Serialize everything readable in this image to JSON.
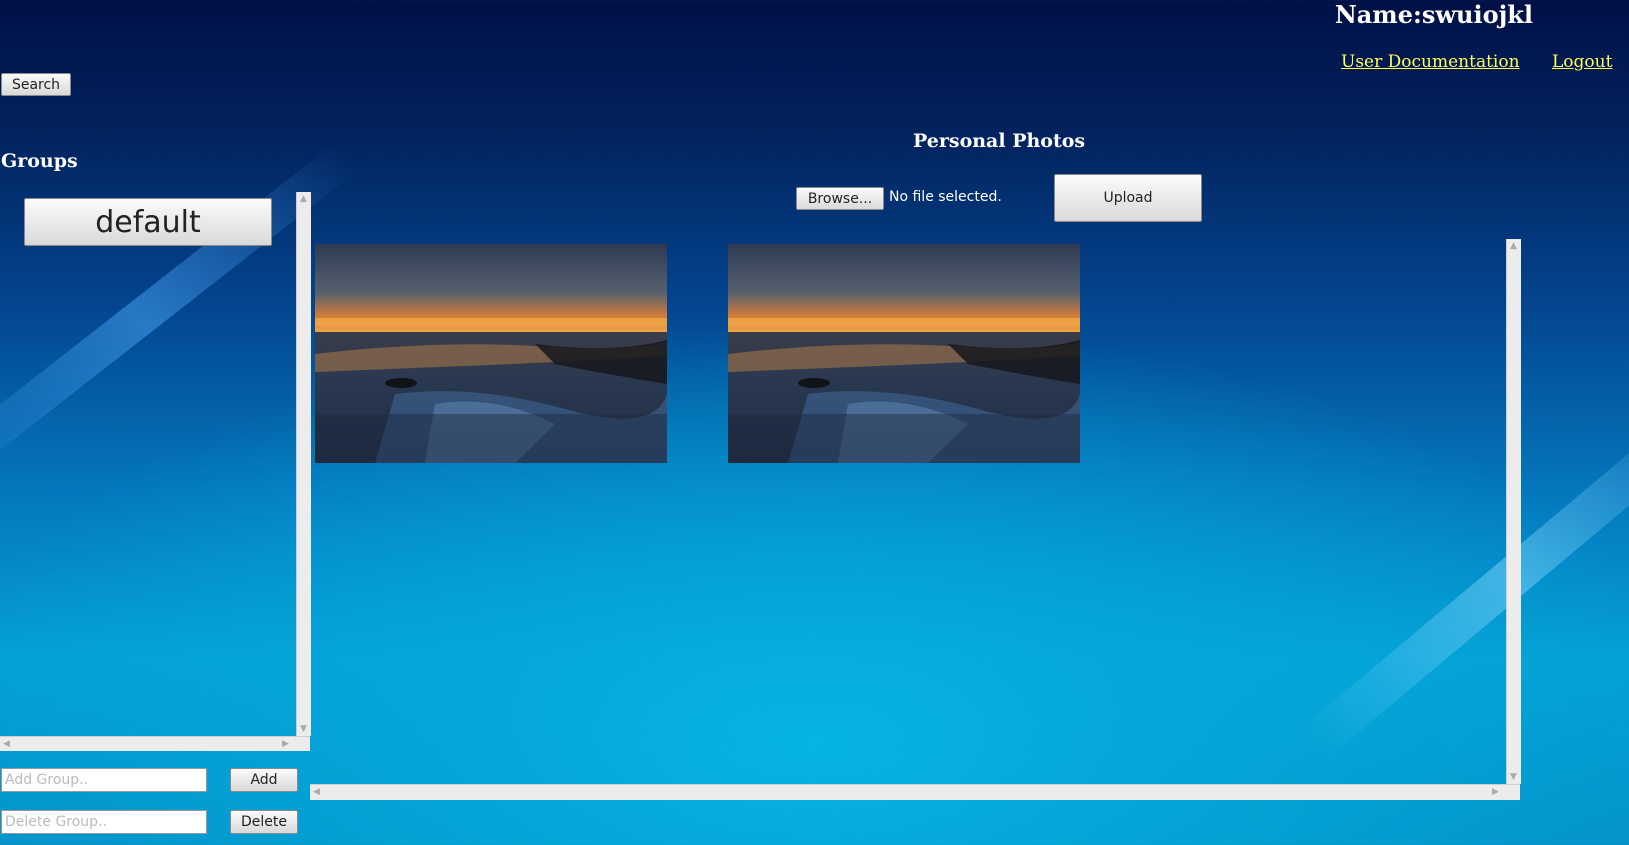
{
  "header": {
    "user_name": "Name:swuiojkl",
    "links": {
      "documentation": "User Documentation",
      "logout": "Logout"
    },
    "search_label": "Search"
  },
  "sidebar": {
    "title": "Groups",
    "groups": [
      {
        "label": "default"
      }
    ],
    "add_placeholder": "Add Group..",
    "add_button": "Add",
    "delete_placeholder": "Delete Group..",
    "delete_button": "Delete"
  },
  "main": {
    "title": "Personal Photos",
    "browse_label": "Browse...",
    "file_status": "No file selected.",
    "upload_label": "Upload",
    "photos": [
      {
        "subject": "sunset-beach"
      },
      {
        "subject": "sunset-beach"
      }
    ]
  },
  "colors": {
    "link": "#ffff55",
    "title": "#ffffff",
    "background_top": "#011046",
    "background_bottom": "#05b4e2"
  }
}
